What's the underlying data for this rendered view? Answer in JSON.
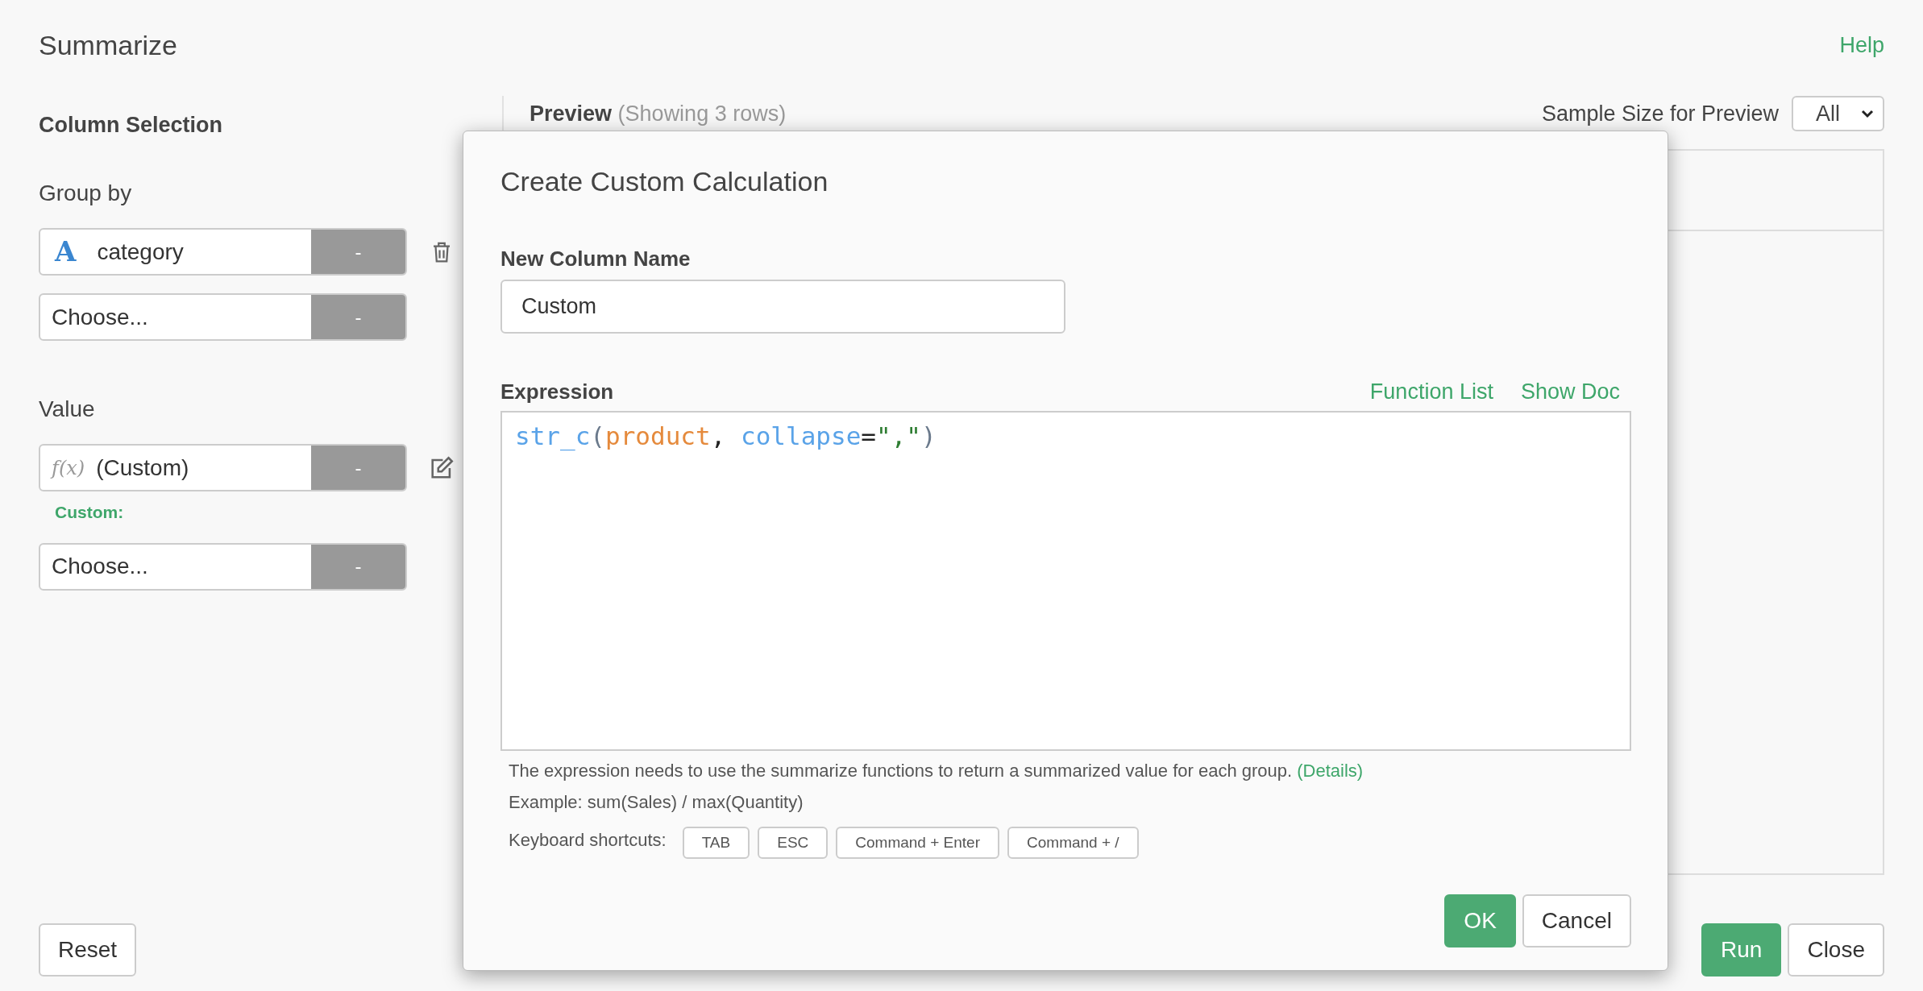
{
  "title": "Summarize",
  "help_link": "Help",
  "column_selection": {
    "heading": "Column Selection",
    "group_by": {
      "label": "Group by",
      "rows": [
        {
          "kind": "column",
          "icon": "A",
          "value": "category",
          "button": "-",
          "trailing": {
            "kind": "delete"
          }
        },
        {
          "kind": "empty",
          "value": "Choose...",
          "button": "-"
        }
      ]
    },
    "value": {
      "label": "Value",
      "rows": [
        {
          "kind": "function",
          "icon": "f(x)",
          "value": "(Custom)",
          "button": "-",
          "trailing": {
            "kind": "edit"
          },
          "note": "Custom:"
        },
        {
          "kind": "empty",
          "value": "Choose...",
          "button": "-"
        }
      ]
    }
  },
  "preview": {
    "title": "Preview",
    "subtitle": "(Showing 3 rows)",
    "sample_label": "Sample Size for Preview",
    "sample_value": "All"
  },
  "buttons_left": [
    "Reset"
  ],
  "buttons_right": [
    {
      "label": "Run",
      "kind": "primary"
    },
    {
      "label": "Close",
      "kind": "default"
    }
  ],
  "dialog": {
    "title": "Create Custom Calculation",
    "name_label": "New Column Name",
    "name_value": "Custom",
    "expression_label": "Expression",
    "links": [
      "Function List",
      "Show Doc"
    ],
    "code": [
      {
        "kind": "func",
        "text": "str_c"
      },
      {
        "kind": "paren",
        "text": "("
      },
      {
        "kind": "column",
        "text": "product"
      },
      {
        "kind": "plain",
        "text": ", "
      },
      {
        "kind": "param",
        "text": "collapse"
      },
      {
        "kind": "op",
        "text": "="
      },
      {
        "kind": "string",
        "text": "\",\""
      },
      {
        "kind": "paren",
        "text": ")"
      }
    ],
    "hint": "The expression needs to use the summarize functions to return a summarized value for each group.",
    "hint_link": "(Details)",
    "example": "Example: sum(Sales) / max(Quantity)",
    "shortcuts_label": "Keyboard shortcuts:",
    "shortcuts": [
      "TAB",
      "ESC",
      "Command + Enter",
      "Command + /"
    ],
    "buttons": [
      {
        "label": "OK",
        "kind": "primary"
      },
      {
        "label": "Cancel",
        "kind": "default"
      }
    ]
  }
}
